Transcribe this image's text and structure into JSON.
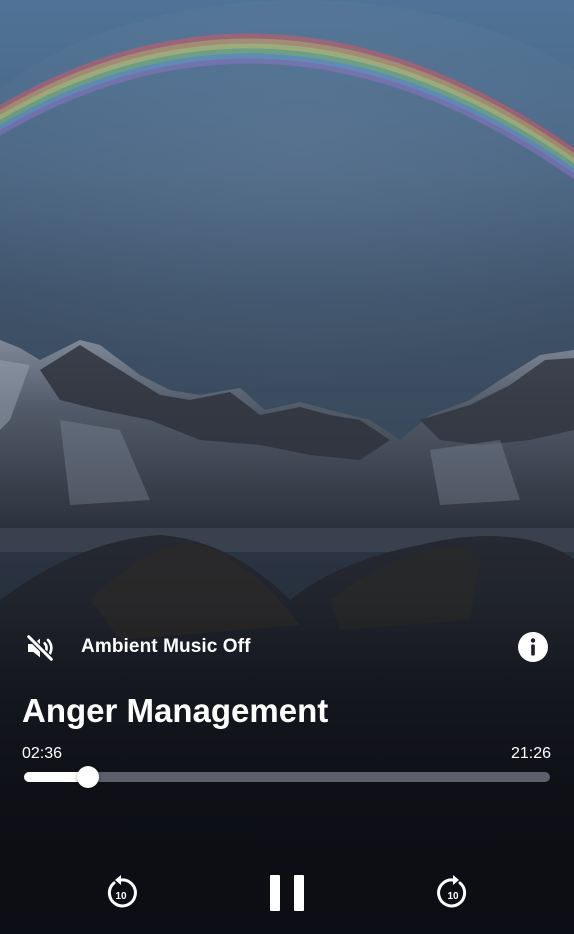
{
  "ambient": {
    "label": "Ambient Music Off",
    "icon": "volume-off-icon"
  },
  "info": {
    "icon": "info-icon"
  },
  "track": {
    "title": "Anger Management",
    "elapsed": "02:36",
    "total": "21:26",
    "progress_fraction": 0.1213
  },
  "controls": {
    "rewind": {
      "icon": "rewind-10-icon",
      "seconds": "10"
    },
    "pause": {
      "icon": "pause-icon"
    },
    "forward": {
      "icon": "forward-10-icon",
      "seconds": "10"
    }
  },
  "background": {
    "subject": "mountains-rainbow-landscape",
    "colors": {
      "sky_top": "#4d6f90",
      "sky_mid": "#3d4f64",
      "ground": "#151820"
    }
  }
}
